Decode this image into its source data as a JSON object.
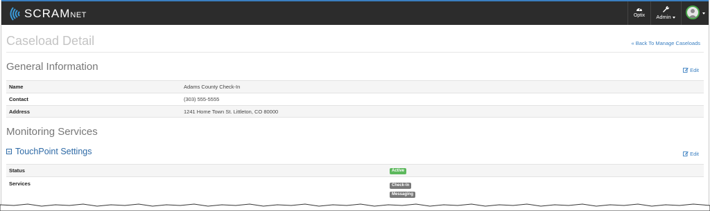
{
  "brand": {
    "name": "SCRAM",
    "suffix": "NET"
  },
  "topnav": {
    "optix_label": "Optix",
    "admin_label": "Admin"
  },
  "page": {
    "title": "Caseload Detail",
    "back_link": "« Back To Manage Caseloads"
  },
  "general": {
    "heading": "General Information",
    "edit_label": "Edit",
    "rows": [
      {
        "key": "Name",
        "value": "Adams County Check-In"
      },
      {
        "key": "Contact",
        "value": "(303) 555-5555"
      },
      {
        "key": "Address",
        "value": "1241 Home Town St. Littleton, CO 80000"
      }
    ]
  },
  "monitoring": {
    "heading": "Monitoring Services",
    "touchpoint": {
      "title": "TouchPoint Settings",
      "edit_label": "Edit",
      "status_key": "Status",
      "status_value": "Active",
      "services_key": "Services",
      "services": [
        "Check-In",
        "Messaging"
      ]
    }
  },
  "colors": {
    "nav_bg": "#2c2c2c",
    "accent": "#3a7fc1",
    "active_badge": "#5cb85c",
    "service_badge": "#777777"
  }
}
